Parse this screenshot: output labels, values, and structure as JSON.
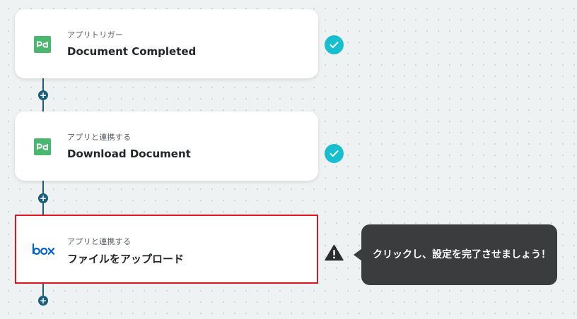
{
  "flow": {
    "steps": [
      {
        "type_label": "アプリトリガー",
        "title": "Document Completed",
        "app_icon": "pandadoc-logo-icon",
        "status": "complete"
      },
      {
        "type_label": "アプリと連携する",
        "title": "Download Document",
        "app_icon": "pandadoc-logo-icon",
        "status": "complete"
      },
      {
        "type_label": "アプリと連携する",
        "title": "ファイルをアップロード",
        "app_icon": "box-logo-icon",
        "status": "warning"
      }
    ],
    "add_step_label": "+"
  },
  "tooltip": {
    "text": "クリックし、設定を完了させましょう！"
  },
  "colors": {
    "connector": "#1b5f78",
    "check": "#16bfd0",
    "selected_border": "#e0141e",
    "pandadoc_green": "#4bb66f",
    "box_blue": "#0061d5",
    "tooltip_bg": "#3a3c3d"
  }
}
